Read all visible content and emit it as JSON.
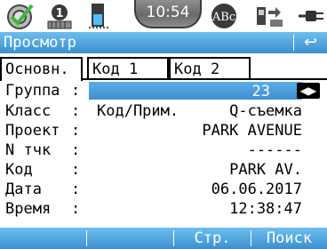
{
  "status_bar": {
    "time": "10:54",
    "icons": [
      "satellite-check-icon",
      "instrument-level-icon",
      "battery-level-icon",
      "abc-input-icon",
      "device-connection-icon",
      "power-plug-icon"
    ]
  },
  "title_bar": {
    "title": "Просмотр",
    "back_icon": "↩"
  },
  "tabs": [
    {
      "label": "Основн.",
      "active": true
    },
    {
      "label": "Код 1",
      "active": false
    },
    {
      "label": "Код 2",
      "active": false
    }
  ],
  "fields": {
    "group": {
      "label": "Группа",
      "value": "23"
    },
    "class": {
      "label": "Класс",
      "value_left": "Код/Прим.",
      "value_right": "Q-съемка"
    },
    "project": {
      "label": "Проект",
      "value": "PARK AVENUE"
    },
    "point_no": {
      "label": "N тчк",
      "value": "------"
    },
    "code": {
      "label": "Код",
      "value": "PARK AV."
    },
    "date": {
      "label": "Дата",
      "value": "06.06.2017"
    },
    "time": {
      "label": "Время",
      "value": "12:38:47"
    }
  },
  "softkeys": [
    "",
    "",
    "Стр.",
    "Поиск"
  ],
  "colors": {
    "accent": "#3b8fd0",
    "accent_light": "#6dbfef"
  }
}
